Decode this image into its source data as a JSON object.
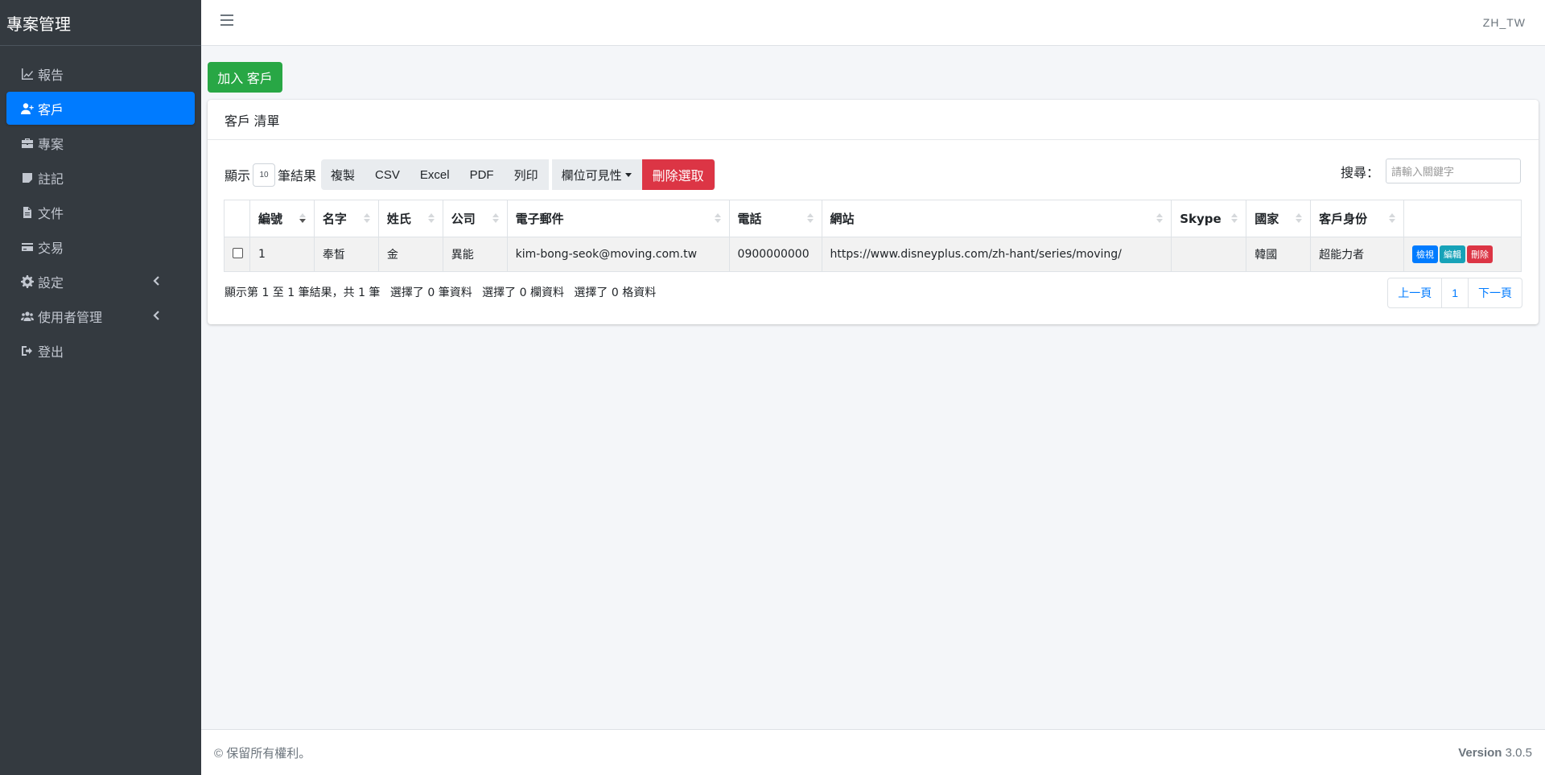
{
  "app": {
    "brand": "專案管理",
    "lang": "ZH_TW"
  },
  "sidebar": {
    "items": [
      {
        "label": "報告",
        "icon": "chart-line-icon"
      },
      {
        "label": "客戶",
        "icon": "user-plus-icon",
        "active": true
      },
      {
        "label": "專案",
        "icon": "briefcase-icon"
      },
      {
        "label": "註記",
        "icon": "sticky-note-icon"
      },
      {
        "label": "文件",
        "icon": "file-icon"
      },
      {
        "label": "交易",
        "icon": "credit-card-icon"
      },
      {
        "label": "設定",
        "icon": "gear-icon",
        "expandable": true
      },
      {
        "label": "使用者管理",
        "icon": "users-icon",
        "expandable": true
      },
      {
        "label": "登出",
        "icon": "sign-out-icon"
      }
    ]
  },
  "main": {
    "add_button": "加入 客戶",
    "card_title": "客戶 清單",
    "length": {
      "prefix": "顯示",
      "value": "10",
      "suffix": "筆結果"
    },
    "export_buttons": [
      "複製",
      "CSV",
      "Excel",
      "PDF",
      "列印"
    ],
    "colvis_button": "欄位可見性",
    "delete_selected": "刪除選取",
    "search": {
      "label": "搜尋：",
      "placeholder": "請輸入關鍵字"
    },
    "table": {
      "columns": [
        "編號",
        "名字",
        "姓氏",
        "公司",
        "電子郵件",
        "電話",
        "網站",
        "Skype",
        "國家",
        "客戶身份"
      ],
      "rows": [
        {
          "id": "1",
          "first_name": "奉晳",
          "last_name": "金",
          "company": "異能",
          "email": "kim-bong-seok@moving.com.tw",
          "phone": "0900000000",
          "website": "https://www.disneyplus.com/zh-hant/series/moving/",
          "skype": "",
          "country": "韓國",
          "status": "超能力者",
          "actions": {
            "view": "檢視",
            "edit": "編輯",
            "delete": "刪除"
          }
        }
      ]
    },
    "info": {
      "summary": "顯示第 1 至 1 筆結果，共 1 筆",
      "rows_selected": "選擇了 0 筆資料",
      "cols_selected": "選擇了 0 欄資料",
      "cells_selected": "選擇了 0 格資料"
    },
    "pagination": {
      "prev": "上一頁",
      "page": "1",
      "next": "下一頁"
    }
  },
  "footer": {
    "copyright": "© 保留所有權利。",
    "version_label": "Version",
    "version": "3.0.5"
  },
  "colors": {
    "sidebar": "#343a40",
    "active": "#007bff",
    "success": "#28a745",
    "danger": "#dc3545",
    "info": "#17a2b8"
  }
}
